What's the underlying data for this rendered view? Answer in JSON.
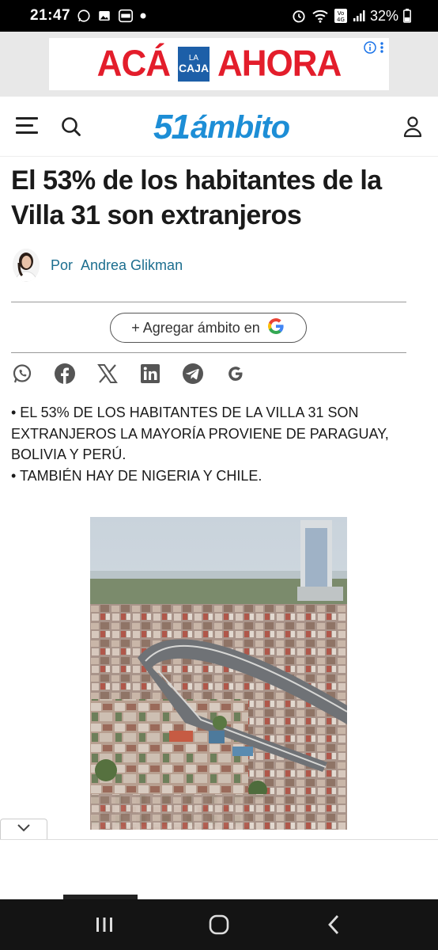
{
  "status_bar": {
    "time": "21:47",
    "battery": "32%",
    "network": "Vo) 4G"
  },
  "top_ad": {
    "text_left": "ACÁ",
    "text_right": "AHORA",
    "logo_line1": "LA",
    "logo_line2": "CAJA"
  },
  "header": {
    "logo_number": "51",
    "logo_word": "ámbito"
  },
  "article": {
    "headline": "El 53% de los habitantes de la Villa 31 son extranjeros",
    "author_prefix": "Por",
    "author_name": "Andrea Glikman",
    "google_chip": "+ Agregar ámbito en",
    "bullets": [
      "• EL 53% DE LOS HABITANTES DE LA VILLA 31 SON EXTRANJEROS LA MAYORÍA PROVIENE DE PARAGUAY, BOLIVIA Y PERÚ.",
      "• TAMBIÉN HAY DE NIGERIA Y CHILE."
    ]
  },
  "share_icons": [
    "whatsapp-icon",
    "facebook-icon",
    "x-icon",
    "linkedin-icon",
    "telegram-icon",
    "google-icon"
  ],
  "colors": {
    "accent": "#1d8ed6",
    "ad_red": "#e31d2b",
    "author_link": "#1c6e8f",
    "nav_bg": "#141414"
  }
}
